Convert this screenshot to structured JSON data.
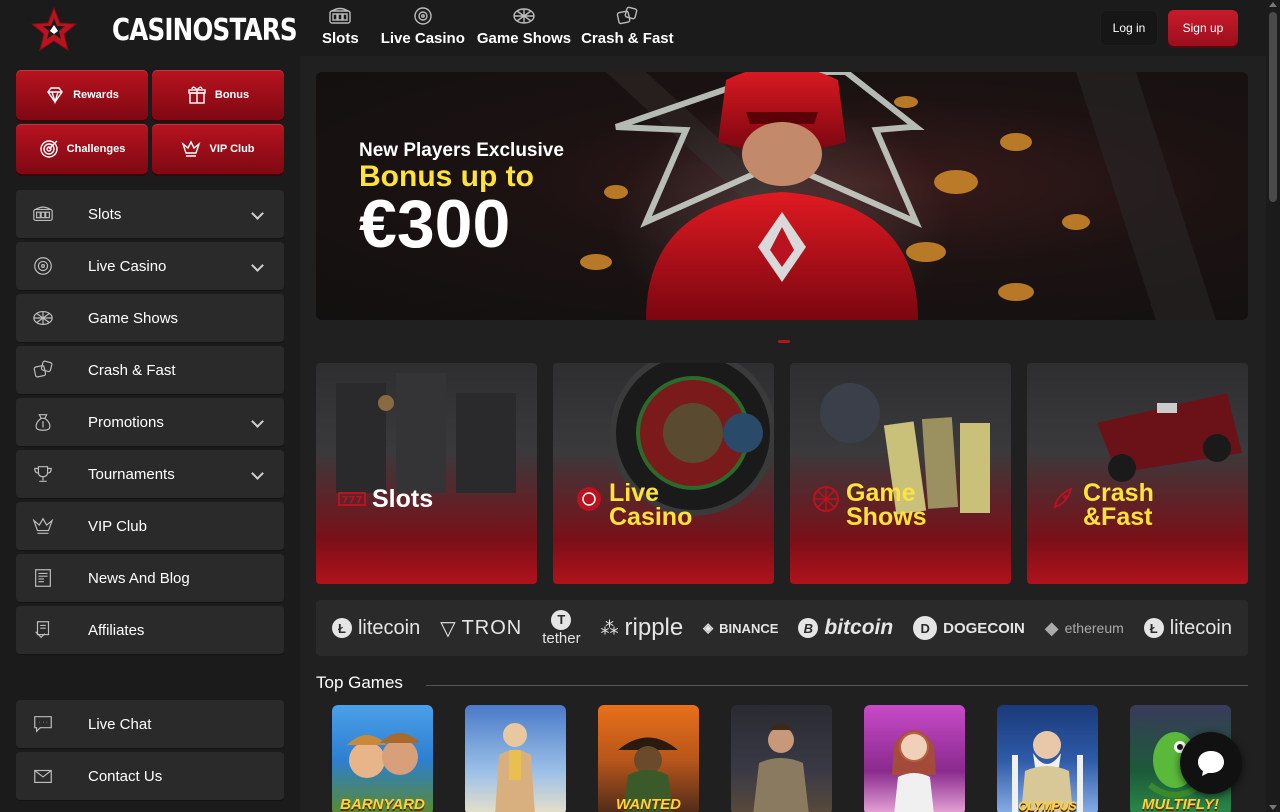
{
  "brand": {
    "name": "CASINOSTARS"
  },
  "topnav": [
    {
      "label": "Slots",
      "icon": "slot-machine-icon"
    },
    {
      "label": "Live Casino",
      "icon": "roulette-icon"
    },
    {
      "label": "Game Shows",
      "icon": "wheel-icon"
    },
    {
      "label": "Crash & Fast",
      "icon": "dice-icon"
    }
  ],
  "auth": {
    "login": "Log in",
    "signup": "Sign up"
  },
  "promo_buttons": [
    {
      "label": "Rewards",
      "icon": "diamond-icon"
    },
    {
      "label": "Bonus",
      "icon": "gift-icon"
    },
    {
      "label": "Challenges",
      "icon": "target-icon"
    },
    {
      "label": "VIP Club",
      "icon": "crown-icon"
    }
  ],
  "sidebar": {
    "items": [
      {
        "label": "Slots",
        "icon": "slot-machine-icon",
        "expandable": true
      },
      {
        "label": "Live Casino",
        "icon": "roulette-icon",
        "expandable": true
      },
      {
        "label": "Game Shows",
        "icon": "wheel-icon",
        "expandable": false
      },
      {
        "label": "Crash & Fast",
        "icon": "dice-icon",
        "expandable": false
      },
      {
        "label": "Promotions",
        "icon": "money-bag-icon",
        "expandable": true
      },
      {
        "label": "Tournaments",
        "icon": "trophy-icon",
        "expandable": true
      },
      {
        "label": "VIP Club",
        "icon": "crown-icon",
        "expandable": false
      },
      {
        "label": "News And Blog",
        "icon": "newspaper-icon",
        "expandable": false
      },
      {
        "label": "Affiliates",
        "icon": "affiliates-icon",
        "expandable": false
      }
    ],
    "bottom": [
      {
        "label": "Live Chat",
        "icon": "chat-icon"
      },
      {
        "label": "Contact Us",
        "icon": "mail-icon"
      }
    ]
  },
  "hero": {
    "subtitle": "New Players Exclusive",
    "bonus": "Bonus up to",
    "amount": "€300"
  },
  "categories": [
    {
      "line1": "Slots",
      "line2": "",
      "icon": "777-icon"
    },
    {
      "line1": "Live",
      "line2": "Casino",
      "icon": "roulette-chip-icon"
    },
    {
      "line1": "Game",
      "line2": "Shows",
      "icon": "wheel-icon"
    },
    {
      "line1": "Crash",
      "line2": "&Fast",
      "icon": "rocket-icon"
    }
  ],
  "crypto": [
    "litecoin",
    "TRON",
    "tether",
    "ripple",
    "BINANCE",
    "bitcoin",
    "DOGECOIN",
    "ethereum",
    "litecoin"
  ],
  "top_games": {
    "title": "Top Games",
    "games": [
      {
        "name": "BARNYARD",
        "bg": "#2e7fd0"
      },
      {
        "name": "",
        "bg": "#3b6fb0"
      },
      {
        "name": "WANTED",
        "bg": "#b8561a"
      },
      {
        "name": "",
        "bg": "#3a3a46"
      },
      {
        "name": "",
        "bg": "#8a2a8e"
      },
      {
        "name": "OLYMPUS",
        "bg": "#2e5aa8"
      },
      {
        "name": "MULTIFLY!",
        "bg": "#1c5a3a"
      }
    ]
  },
  "colors": {
    "accent": "#b8131f",
    "highlight": "#ffe23a",
    "panel": "#2a2a2a",
    "background": "#1b1b1b"
  }
}
